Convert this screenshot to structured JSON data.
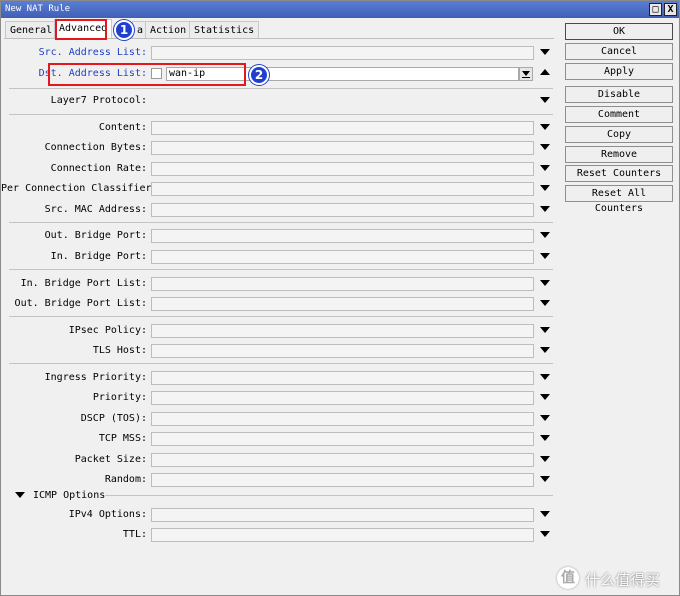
{
  "window": {
    "title": "New NAT Rule",
    "max_glyph": "□",
    "close_glyph": "X"
  },
  "tabs": [
    "General",
    "Advanced",
    "a",
    "Action",
    "Statistics"
  ],
  "fields": {
    "src_address_list": "Src. Address List:",
    "dst_address_list": "Dst. Address List:",
    "dst_address_value": "wan-ip",
    "layer7": "Layer7 Protocol:",
    "content": "Content:",
    "connection_bytes": "Connection Bytes:",
    "connection_rate": "Connection Rate:",
    "per_connection_classifier": "Per Connection Classifier:",
    "src_mac": "Src. MAC Address:",
    "out_bridge_port": "Out. Bridge Port:",
    "in_bridge_port": "In. Bridge Port:",
    "in_bridge_port_list": "In. Bridge Port List:",
    "out_bridge_port_list": "Out. Bridge Port List:",
    "ipsec_policy": "IPsec Policy:",
    "tls_host": "TLS Host:",
    "ingress_priority": "Ingress Priority:",
    "priority": "Priority:",
    "dscp": "DSCP (TOS):",
    "tcp_mss": "TCP MSS:",
    "packet_size": "Packet Size:",
    "random": "Random:",
    "icmp_section": "ICMP Options",
    "ipv4_options": "IPv4 Options:",
    "ttl": "TTL:"
  },
  "buttons": {
    "ok": "OK",
    "cancel": "Cancel",
    "apply": "Apply",
    "disable": "Disable",
    "comment": "Comment",
    "copy": "Copy",
    "remove": "Remove",
    "reset_counters": "Reset Counters",
    "reset_all_counters": "Reset All Counters"
  },
  "annotations": {
    "badge1": "1",
    "badge2": "2"
  },
  "watermark": {
    "icon": "值",
    "text": "什么值得买"
  },
  "colors": {
    "highlight": "#e3171c",
    "badge": "#1f3fd0",
    "link_label": "#1d3fc4",
    "titlebar": "#4a6cc8"
  }
}
